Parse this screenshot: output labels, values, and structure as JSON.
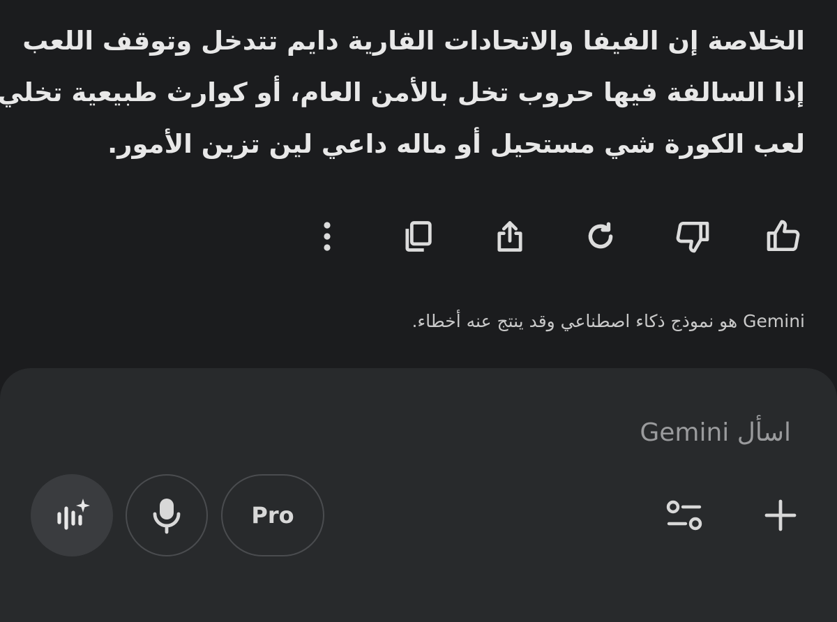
{
  "response": {
    "lines": [
      "الخلاصة إن الفيفا والاتحادات القارية دايم تتدخل وتوقف اللعب",
      "إذا السالفة فيها حروب تخل بالأمن العام، أو كوارث طبيعية تخلي",
      "لعب الكورة شي مستحيل أو ماله داعي لين تزين الأمور."
    ]
  },
  "actions": {
    "icons": [
      "thumbs-up-icon",
      "thumbs-down-icon",
      "refresh-icon",
      "share-icon",
      "copy-icon",
      "more-vert-icon"
    ]
  },
  "disclaimer": "Gemini هو نموذج ذكاء اصطناعي وقد ينتج عنه أخطاء.",
  "composer": {
    "placeholder": "اسأل Gemini",
    "pro_label": "Pro",
    "icons": [
      "add-icon",
      "tune-icon",
      "mic-icon",
      "live-spark-icon"
    ]
  },
  "colors": {
    "background": "#1b1c1e",
    "composer": "#282a2c",
    "text": "#e8e8e8",
    "muted": "#9a9b9d"
  }
}
